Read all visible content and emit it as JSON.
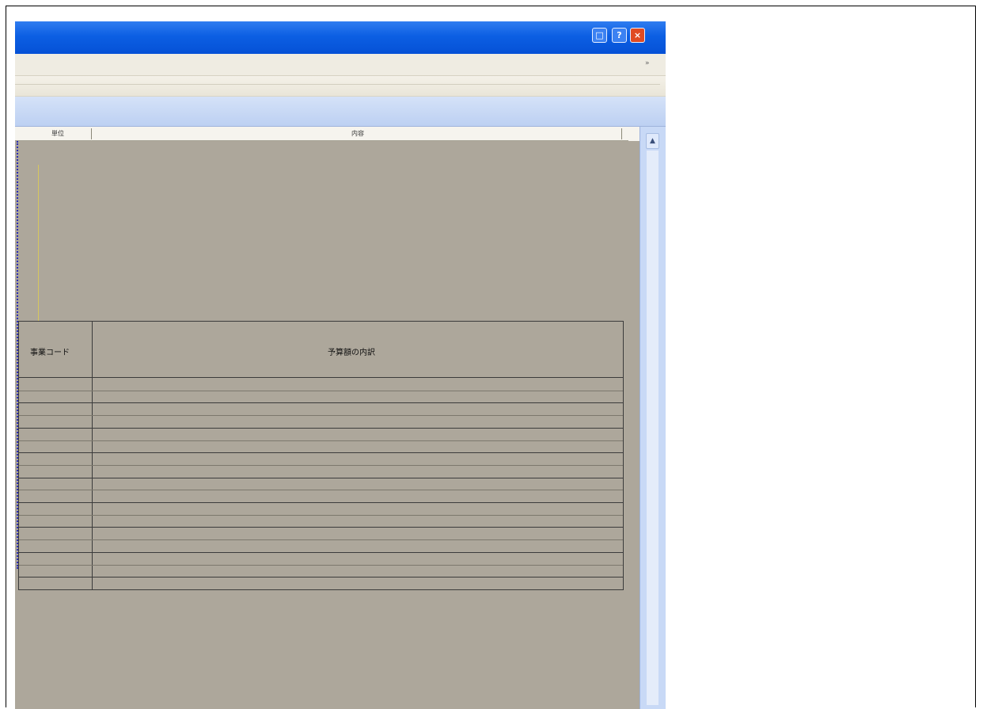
{
  "window": {
    "title": "",
    "controls": {
      "restore_icon": "restore-icon",
      "help_icon": "help-icon",
      "close_icon": "close-icon",
      "restore_glyph": "□",
      "help_glyph": "?",
      "close_glyph": "×"
    }
  },
  "menubar": {
    "overflow_glyph": "»"
  },
  "ruler": {
    "label_1": "単位",
    "label_2": "内容"
  },
  "scrollbar": {
    "up_glyph": "▲"
  },
  "table": {
    "headers": [
      "事業コード",
      "予算額の内訳"
    ],
    "rows": 17
  },
  "colors": {
    "titlebar": "#0c5fe3",
    "canvas": "#ada79b",
    "margin_guide": "#2d2fb4",
    "menubar": "#efece2"
  }
}
